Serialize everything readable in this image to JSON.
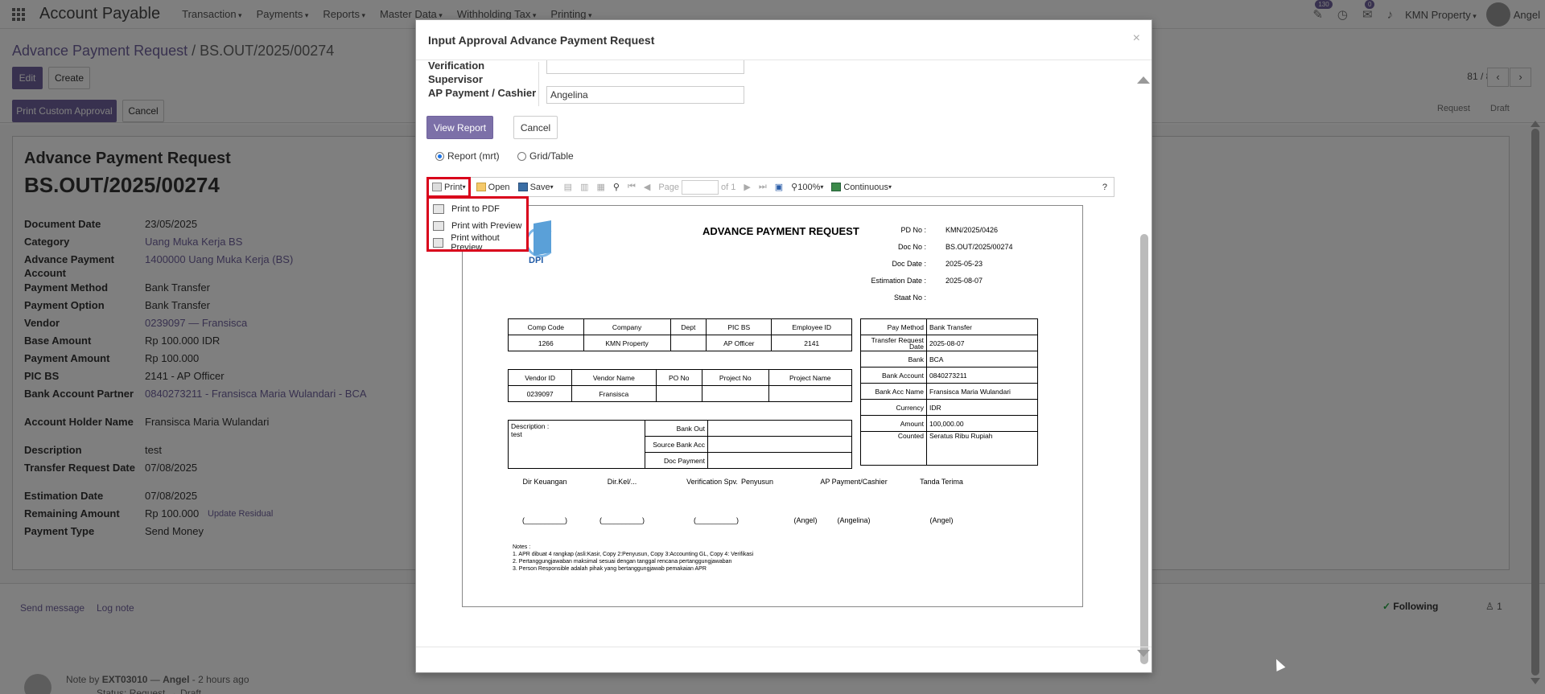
{
  "navbar": {
    "brand": "Account Payable",
    "menu": [
      "Transaction",
      "Payments",
      "Reports",
      "Master Data",
      "Withholding Tax",
      "Printing"
    ],
    "badge_activity": "130",
    "badge_messages": "0",
    "company": "KMN Property",
    "user": "Angel"
  },
  "control": {
    "breadcrumb_parent": "Advance Payment Request",
    "breadcrumb_current": "BS.OUT/2025/00274",
    "edit": "Edit",
    "create": "Create",
    "pager": "81 / 81",
    "print_custom": "Print Custom Approval",
    "cancel": "Cancel",
    "stage_request": "Request",
    "stage_draft": "Draft"
  },
  "form": {
    "title": "Advance Payment Request",
    "number": "BS.OUT/2025/00274",
    "fields": [
      {
        "label": "Document Date",
        "value": "23/05/2025"
      },
      {
        "label": "Category",
        "value": "Uang Muka Kerja BS"
      },
      {
        "label": "Advance Payment Account",
        "value": "1400000 Uang Muka Kerja (BS)"
      },
      {
        "label": "Payment Method",
        "value": "Bank Transfer"
      },
      {
        "label": "Payment Option",
        "value": "Bank Transfer"
      },
      {
        "label": "Vendor",
        "value": "0239097 — Fransisca"
      },
      {
        "label": "Base Amount",
        "value": "Rp 100.000  IDR"
      },
      {
        "label": "Payment Amount",
        "value": "Rp 100.000"
      },
      {
        "label": "PIC BS",
        "value": "2141 - AP Officer"
      },
      {
        "label": "Bank Account Partner",
        "value": "0840273211 - Fransisca Maria Wulandari - BCA"
      },
      {
        "label": "Account Holder Name",
        "value": "Fransisca Maria Wulandari"
      },
      {
        "label": "Description",
        "value": "test"
      },
      {
        "label": "Transfer Request Date",
        "value": "07/08/2025"
      },
      {
        "label": "Estimation Date",
        "value": "07/08/2025"
      },
      {
        "label": "Remaining Amount",
        "value": "Rp 100.000"
      },
      {
        "label": "Payment Type",
        "value": "Send Money"
      }
    ],
    "update_residual": "Update Residual"
  },
  "chatter": {
    "send_message": "Send message",
    "log_note": "Log note",
    "following": "Following",
    "followers": "1",
    "note_author_prefix": "Note by",
    "note_author": "EXT03010",
    "note_sep": "—",
    "note_user": "Angel",
    "note_time": "- 2 hours ago",
    "note_status": "Status: Request → Draft"
  },
  "modal": {
    "title": "Input Approval Advance Payment Request",
    "label_verification": "Verification",
    "label_supervisor": "Supervisor",
    "label_ap": "AP Payment / Cashier",
    "ap_value": "Angelina",
    "view_report": "View Report",
    "cancel": "Cancel",
    "radio_report": "Report (mrt)",
    "radio_grid": "Grid/Table"
  },
  "toolbar": {
    "print": "Print",
    "open": "Open",
    "save": "Save",
    "page_label": "Page",
    "of_pages": "of 1",
    "zoom": "100%",
    "view_mode": "Continuous",
    "help": "?"
  },
  "print_menu": [
    "Print to PDF",
    "Print with Preview",
    "Print without Preview"
  ],
  "report": {
    "title": "ADVANCE PAYMENT REQUEST",
    "logo_text": "DPI",
    "meta": [
      {
        "label": "PD No",
        "value": "KMN/2025/0426"
      },
      {
        "label": "Doc No",
        "value": "BS.OUT/2025/00274"
      },
      {
        "label": "Doc Date",
        "value": "2025-05-23"
      },
      {
        "label": "Estimation Date",
        "value": "2025-08-07"
      },
      {
        "label": "Staat No",
        "value": ""
      }
    ],
    "t1_head": [
      "Comp Code",
      "Company",
      "Dept",
      "PIC BS",
      "Employee ID"
    ],
    "t1_row": [
      "1266",
      "KMN Property",
      "",
      "AP Officer",
      "2141"
    ],
    "t2_head": [
      "Vendor ID",
      "Vendor Name",
      "PO No",
      "Project No",
      "Project Name"
    ],
    "t2_row": [
      "0239097",
      "Fransisca",
      "",
      "",
      ""
    ],
    "desc_label": "Description :",
    "desc_value": "test",
    "bank_out": "Bank Out",
    "source_bank": "Source Bank Acc",
    "doc_payment": "Doc Payment",
    "right": [
      {
        "label": "Pay Method",
        "value": "Bank Transfer"
      },
      {
        "label": "Transfer Request Date",
        "value": "2025-08-07"
      },
      {
        "label": "Bank",
        "value": "BCA"
      },
      {
        "label": "Bank Account",
        "value": "0840273211"
      },
      {
        "label": "Bank Acc Name",
        "value": "Fransisca Maria Wulandari"
      },
      {
        "label": "Currency",
        "value": "IDR"
      },
      {
        "label": "Amount",
        "value": "100,000.00"
      },
      {
        "label": "Counted",
        "value": "Seratus Ribu Rupiah"
      }
    ],
    "signers": [
      "Dir Keuangan",
      "Dir.Kel/...",
      "Verification Spv.",
      "Penyusun",
      "AP Payment/Cashier",
      "Tanda Terima"
    ],
    "sign_values": [
      "(__________)",
      "(__________)",
      "(__________)",
      "(Angel)",
      "(Angelina)",
      "(Angel)"
    ],
    "notes": [
      "Notes :",
      "1. APR dibuat 4 rangkap (asli:Kasir, Copy 2:Penyusun, Copy 3:Accounting GL, Copy 4: Verifikasi",
      "2. Pertanggungjawaban maksimal sesuai dengan tanggal rencana pertanggungjawaban",
      "3. Person Responsible adalah pihak yang bertanggungjawab pemakaian APR"
    ]
  }
}
